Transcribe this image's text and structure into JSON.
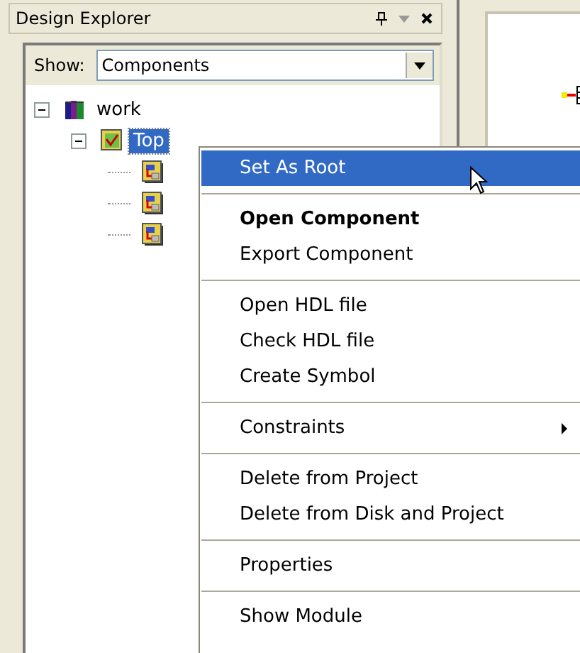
{
  "panel": {
    "title": "Design Explorer",
    "show_label": "Show:",
    "show_value": "Components"
  },
  "tree": [
    {
      "label": "work",
      "kind": "library",
      "expanded": true,
      "selected": false,
      "children": [
        {
          "label": "Top",
          "kind": "design",
          "expanded": true,
          "selected": true,
          "children": [
            {
              "kind": "module"
            },
            {
              "kind": "module"
            },
            {
              "kind": "module"
            }
          ]
        }
      ]
    }
  ],
  "context_menu": [
    {
      "kind": "item",
      "label": "Set As Root",
      "selected": true,
      "default": false,
      "submenu": false
    },
    {
      "kind": "separator"
    },
    {
      "kind": "item",
      "label": "Open Component",
      "selected": false,
      "default": true,
      "submenu": false
    },
    {
      "kind": "item",
      "label": "Export Component",
      "selected": false,
      "default": false,
      "submenu": false
    },
    {
      "kind": "separator"
    },
    {
      "kind": "item",
      "label": "Open HDL file",
      "selected": false,
      "default": false,
      "submenu": false
    },
    {
      "kind": "item",
      "label": "Check HDL file",
      "selected": false,
      "default": false,
      "submenu": false
    },
    {
      "kind": "item",
      "label": "Create Symbol",
      "selected": false,
      "default": false,
      "submenu": false
    },
    {
      "kind": "separator"
    },
    {
      "kind": "item",
      "label": "Constraints",
      "selected": false,
      "default": false,
      "submenu": true
    },
    {
      "kind": "separator"
    },
    {
      "kind": "item",
      "label": "Delete from Project",
      "selected": false,
      "default": false,
      "submenu": false
    },
    {
      "kind": "item",
      "label": "Delete from Disk and Project",
      "selected": false,
      "default": false,
      "submenu": false
    },
    {
      "kind": "separator"
    },
    {
      "kind": "item",
      "label": "Properties",
      "selected": false,
      "default": false,
      "submenu": false
    },
    {
      "kind": "separator"
    },
    {
      "kind": "item",
      "label": "Show Module",
      "selected": false,
      "default": false,
      "submenu": false
    }
  ]
}
